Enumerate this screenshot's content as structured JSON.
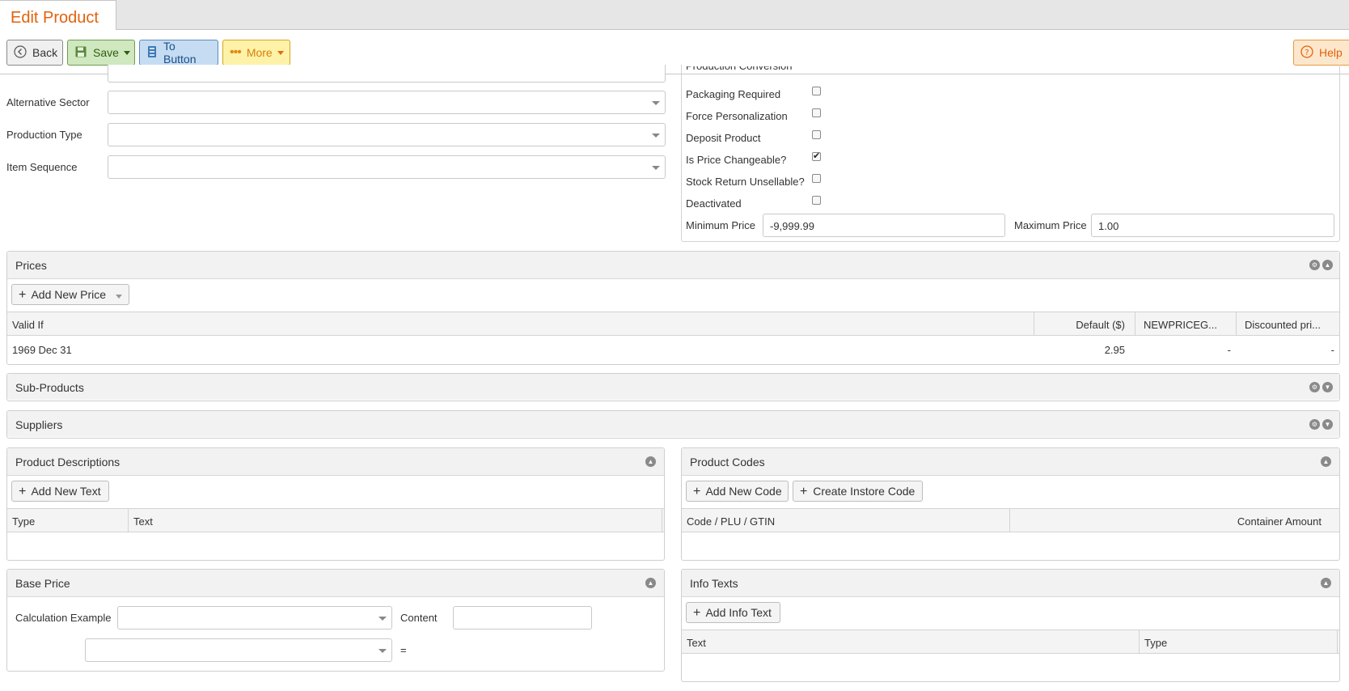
{
  "tab": {
    "title": "Edit Product"
  },
  "toolbar": {
    "back": "Back",
    "save": "Save",
    "to_button": "To Button",
    "more": "More",
    "help": "Help"
  },
  "left_form": {
    "alternative_sector": {
      "label": "Alternative Sector",
      "value": ""
    },
    "production_type": {
      "label": "Production Type",
      "value": ""
    },
    "item_sequence": {
      "label": "Item Sequence",
      "value": ""
    }
  },
  "right_form": {
    "cut_label": "Production Conversion",
    "checkboxes": [
      {
        "label": "Packaging Required",
        "checked": false
      },
      {
        "label": "Force Personalization",
        "checked": false
      },
      {
        "label": "Deposit Product",
        "checked": false
      },
      {
        "label": "Is Price Changeable?",
        "checked": true
      },
      {
        "label": "Stock Return Unsellable?",
        "checked": false
      },
      {
        "label": "Deactivated",
        "checked": false
      }
    ],
    "minimum_price": {
      "label": "Minimum Price",
      "value": "-9,999.99"
    },
    "maximum_price": {
      "label": "Maximum Price",
      "value": "1.00"
    }
  },
  "prices": {
    "title": "Prices",
    "add_button": "Add New Price",
    "columns": [
      "Valid If",
      "Default ($)",
      "NEWPRICEG...",
      "Discounted pri..."
    ],
    "rows": [
      {
        "valid_if": "1969 Dec 31",
        "default": "2.95",
        "newprice": "-",
        "discounted": "-"
      }
    ]
  },
  "sub_products": {
    "title": "Sub-Products"
  },
  "suppliers": {
    "title": "Suppliers"
  },
  "product_descriptions": {
    "title": "Product Descriptions",
    "add_button": "Add New Text",
    "columns": [
      "Type",
      "Text"
    ]
  },
  "product_codes": {
    "title": "Product Codes",
    "add_button": "Add New Code",
    "create_button": "Create Instore Code",
    "columns": [
      "Code / PLU / GTIN",
      "Container Amount"
    ]
  },
  "base_price": {
    "title": "Base Price",
    "calc_label": "Calculation Example",
    "content_label": "Content",
    "equals": "="
  },
  "info_texts": {
    "title": "Info Texts",
    "add_button": "Add Info Text",
    "columns": [
      "Text",
      "Type"
    ]
  }
}
